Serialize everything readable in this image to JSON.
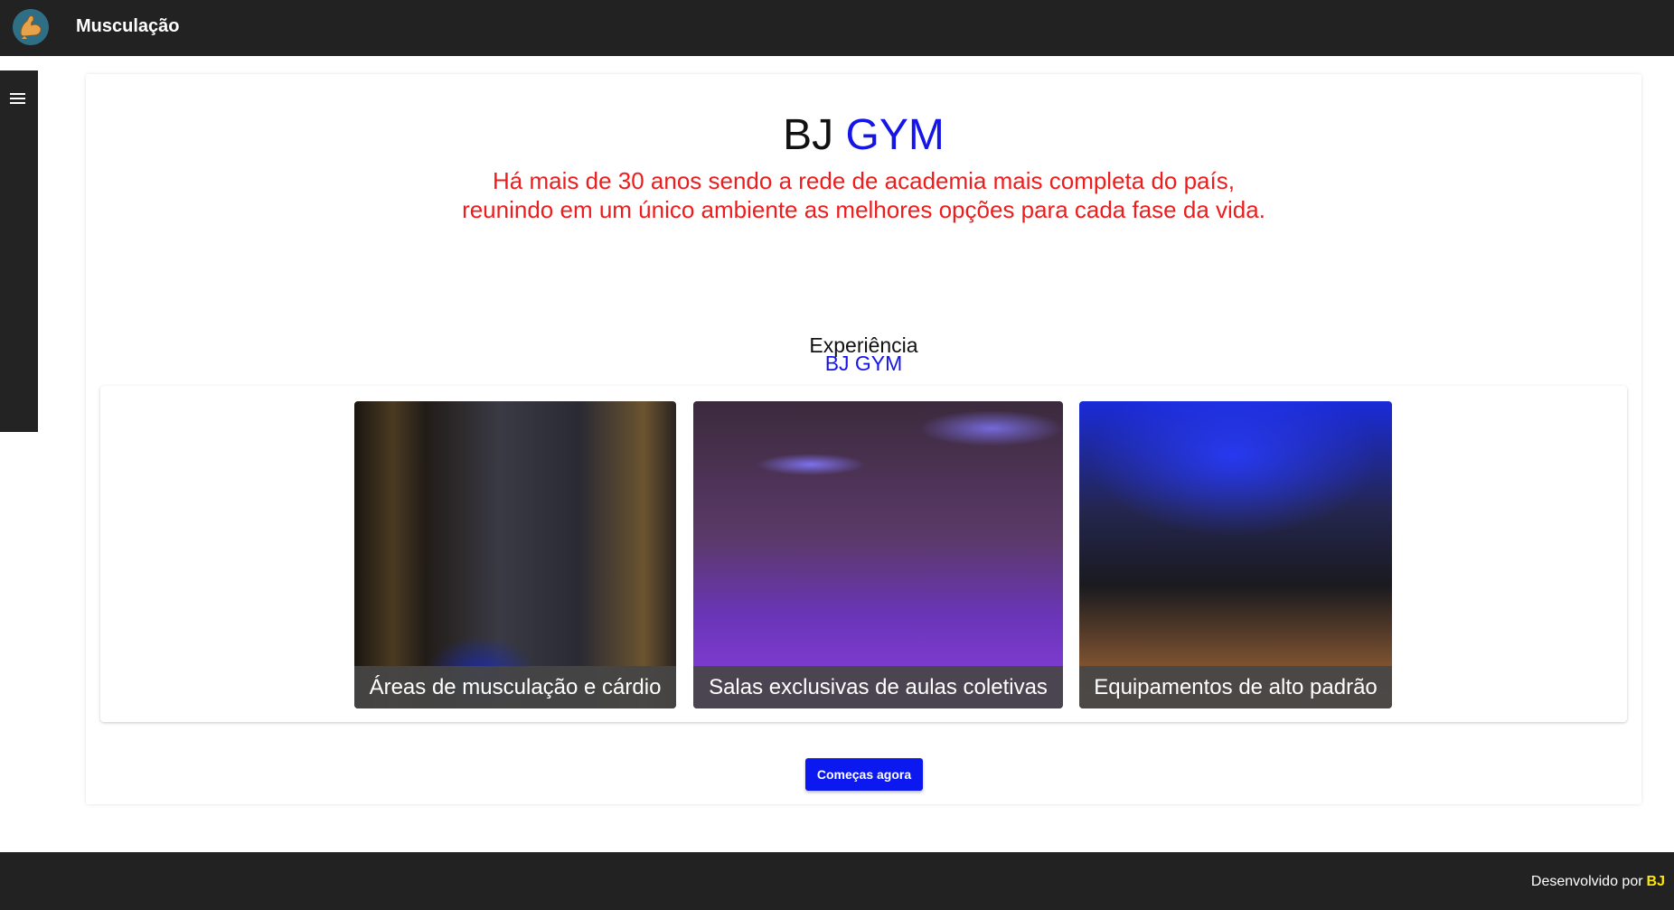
{
  "header": {
    "app_title": "Musculação",
    "logo_icon": "flexed-arm-icon"
  },
  "sidebar": {
    "menu_icon": "hamburger-menu-icon"
  },
  "hero": {
    "title_part1": "BJ",
    "title_part2": "GYM",
    "subtitle_line1": "Há mais de 30 anos sendo a rede de academia mais completa do país,",
    "subtitle_line2": "reunindo em um único ambiente as melhores opções para cada fase da vida."
  },
  "experience": {
    "title_line1": "Experiência",
    "title_line2": "BJ GYM"
  },
  "gallery": {
    "tiles": [
      {
        "caption": "Áreas de musculação e cárdio"
      },
      {
        "caption": "Salas exclusivas de aulas coletivas"
      },
      {
        "caption": "Equipamentos de alto padrão"
      }
    ]
  },
  "cta": {
    "label": "Começas agora"
  },
  "footer": {
    "credit_text": "Desenvolvido por",
    "credit_brand": "BJ"
  },
  "colors": {
    "accent_blue": "#1515e8",
    "subtitle_red": "#ee1c1c",
    "bar_dark": "#222222",
    "brand_yellow": "#ffe800"
  }
}
